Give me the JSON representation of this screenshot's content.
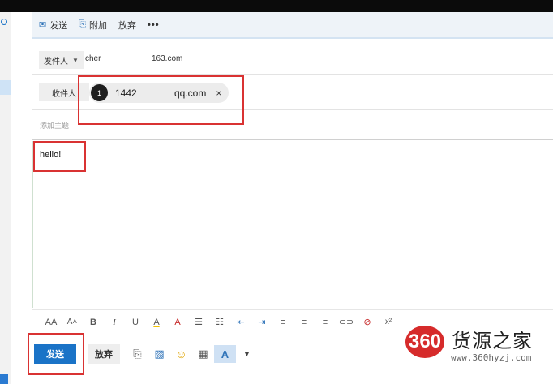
{
  "toolbar": {
    "send_label": "发送",
    "attach_label": "附加",
    "discard_label": "放弃",
    "more_label": "•••"
  },
  "from": {
    "button_label": "发件人",
    "sender_name": "cher",
    "sender_domain": "163.com"
  },
  "to": {
    "button_label": "收件人",
    "recipient_avatar": "1",
    "recipient_number": "1442",
    "recipient_domain": "qq.com",
    "remove_label": "×"
  },
  "subject": {
    "placeholder": "添加主题",
    "value": ""
  },
  "body": {
    "text": "hello!"
  },
  "format_bar": [
    {
      "name": "font-size-icon",
      "glyph": "AA"
    },
    {
      "name": "grow-font-icon",
      "glyph": "A˄"
    },
    {
      "name": "bold-icon",
      "glyph": "B"
    },
    {
      "name": "italic-icon",
      "glyph": "I"
    },
    {
      "name": "underline-icon",
      "glyph": "U"
    },
    {
      "name": "highlight-icon",
      "glyph": "A"
    },
    {
      "name": "font-color-icon",
      "glyph": "A"
    },
    {
      "name": "bullets-icon",
      "glyph": "☰"
    },
    {
      "name": "numbering-icon",
      "glyph": "☷"
    },
    {
      "name": "decrease-indent-icon",
      "glyph": "⇤"
    },
    {
      "name": "increase-indent-icon",
      "glyph": "⇥"
    },
    {
      "name": "align-left-icon",
      "glyph": "≡"
    },
    {
      "name": "align-center-icon",
      "glyph": "≡"
    },
    {
      "name": "align-right-icon",
      "glyph": "≡"
    },
    {
      "name": "link-icon",
      "glyph": "⊂⊃"
    },
    {
      "name": "remove-link-icon",
      "glyph": "⊘"
    },
    {
      "name": "superscript-icon",
      "glyph": "x²"
    }
  ],
  "actions": {
    "send_label": "发送",
    "discard_label": "放弃"
  },
  "watermark": {
    "logo_text": "360",
    "brand": "货源之家",
    "url": "www.360hyzj.com"
  },
  "colors": {
    "accent": "#1a73c7",
    "highlight_box": "#d93232",
    "toolbar_bg": "#eef3f8"
  }
}
